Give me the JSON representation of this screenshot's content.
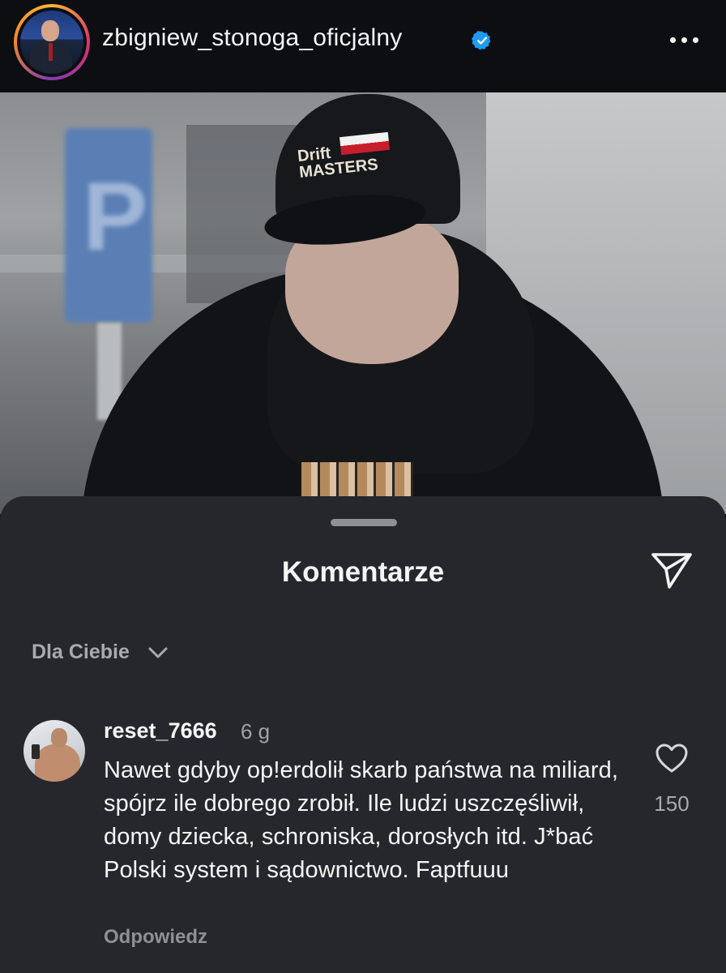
{
  "header": {
    "username": "zbigniew_stonoga_oficjalny",
    "verified_icon": "verified-badge-icon",
    "more_icon": "more-horizontal-icon",
    "verified_color": "#1d9bf0"
  },
  "post": {
    "image_description_icon": "post-photo"
  },
  "comments_sheet": {
    "title": "Komentarze",
    "share_icon": "paper-plane-icon",
    "filter_label": "Dla Ciebie",
    "filter_icon": "chevron-down-icon",
    "comments": [
      {
        "username": "reset_7666",
        "time": "6 g",
        "text": "Nawet gdyby op!erdolił skarb państwa na miliard, spójrz ile dobrego zrobił. Ile ludzi uszczęśliwił, domy dziecka, schroniska, dorosłych itd. J*bać Polski system i sądownictwo. Faptfuuu",
        "reply_label": "Odpowiedz",
        "like_icon": "heart-icon",
        "like_count": "150"
      }
    ]
  },
  "colors": {
    "header_bg": "#0c0e12",
    "sheet_bg": "#25272c",
    "text_primary": "#f5f5f5",
    "text_secondary": "#a8aab0"
  }
}
